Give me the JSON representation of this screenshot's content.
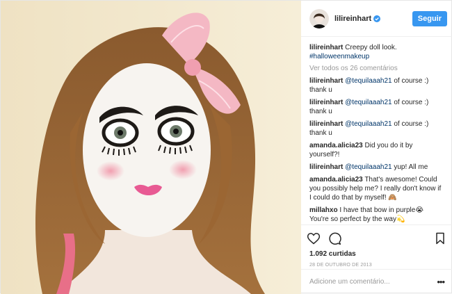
{
  "header": {
    "username": "lilireinhart",
    "follow_label": "Seguir"
  },
  "caption": {
    "username": "lilireinhart",
    "text": "Creepy doll look.",
    "hashtag": "#halloweenmakeup"
  },
  "view_all_comments": "Ver todos os 26 comentários",
  "comments": [
    {
      "user": "lilireinhart",
      "mention": "@tequilaaah21",
      "text": " of course :) thank u"
    },
    {
      "user": "lilireinhart",
      "mention": "@tequilaaah21",
      "text": " of course :) thank u"
    },
    {
      "user": "lilireinhart",
      "mention": "@tequilaaah21",
      "text": " of course :) thank u"
    },
    {
      "user": "amanda.alicia23",
      "mention": "",
      "text": "Did you do it by yourself?!"
    },
    {
      "user": "lilireinhart",
      "mention": "@tequilaaah21",
      "text": " yup! All me"
    },
    {
      "user": "amanda.alicia23",
      "mention": "",
      "text": "That's awesome! Could you possibly help me? I really don't know if I could do that by myself! 🙈"
    },
    {
      "user": "millahxo",
      "mention": "",
      "text": "I have that bow in purple😭 You're so perfect by the way💫"
    }
  ],
  "likes": "1.092 curtidas",
  "date": "28 DE OUTUBRO DE 2013",
  "add_comment_placeholder": "Adicione um comentário...",
  "more_options": "•••",
  "icons": {
    "like": "heart-icon",
    "comment": "comment-icon",
    "save": "bookmark-icon",
    "verified": "verified-badge-icon"
  },
  "colors": {
    "follow_button": "#3897f0",
    "link": "#003569",
    "verified": "#3897f0",
    "muted": "#999999"
  }
}
